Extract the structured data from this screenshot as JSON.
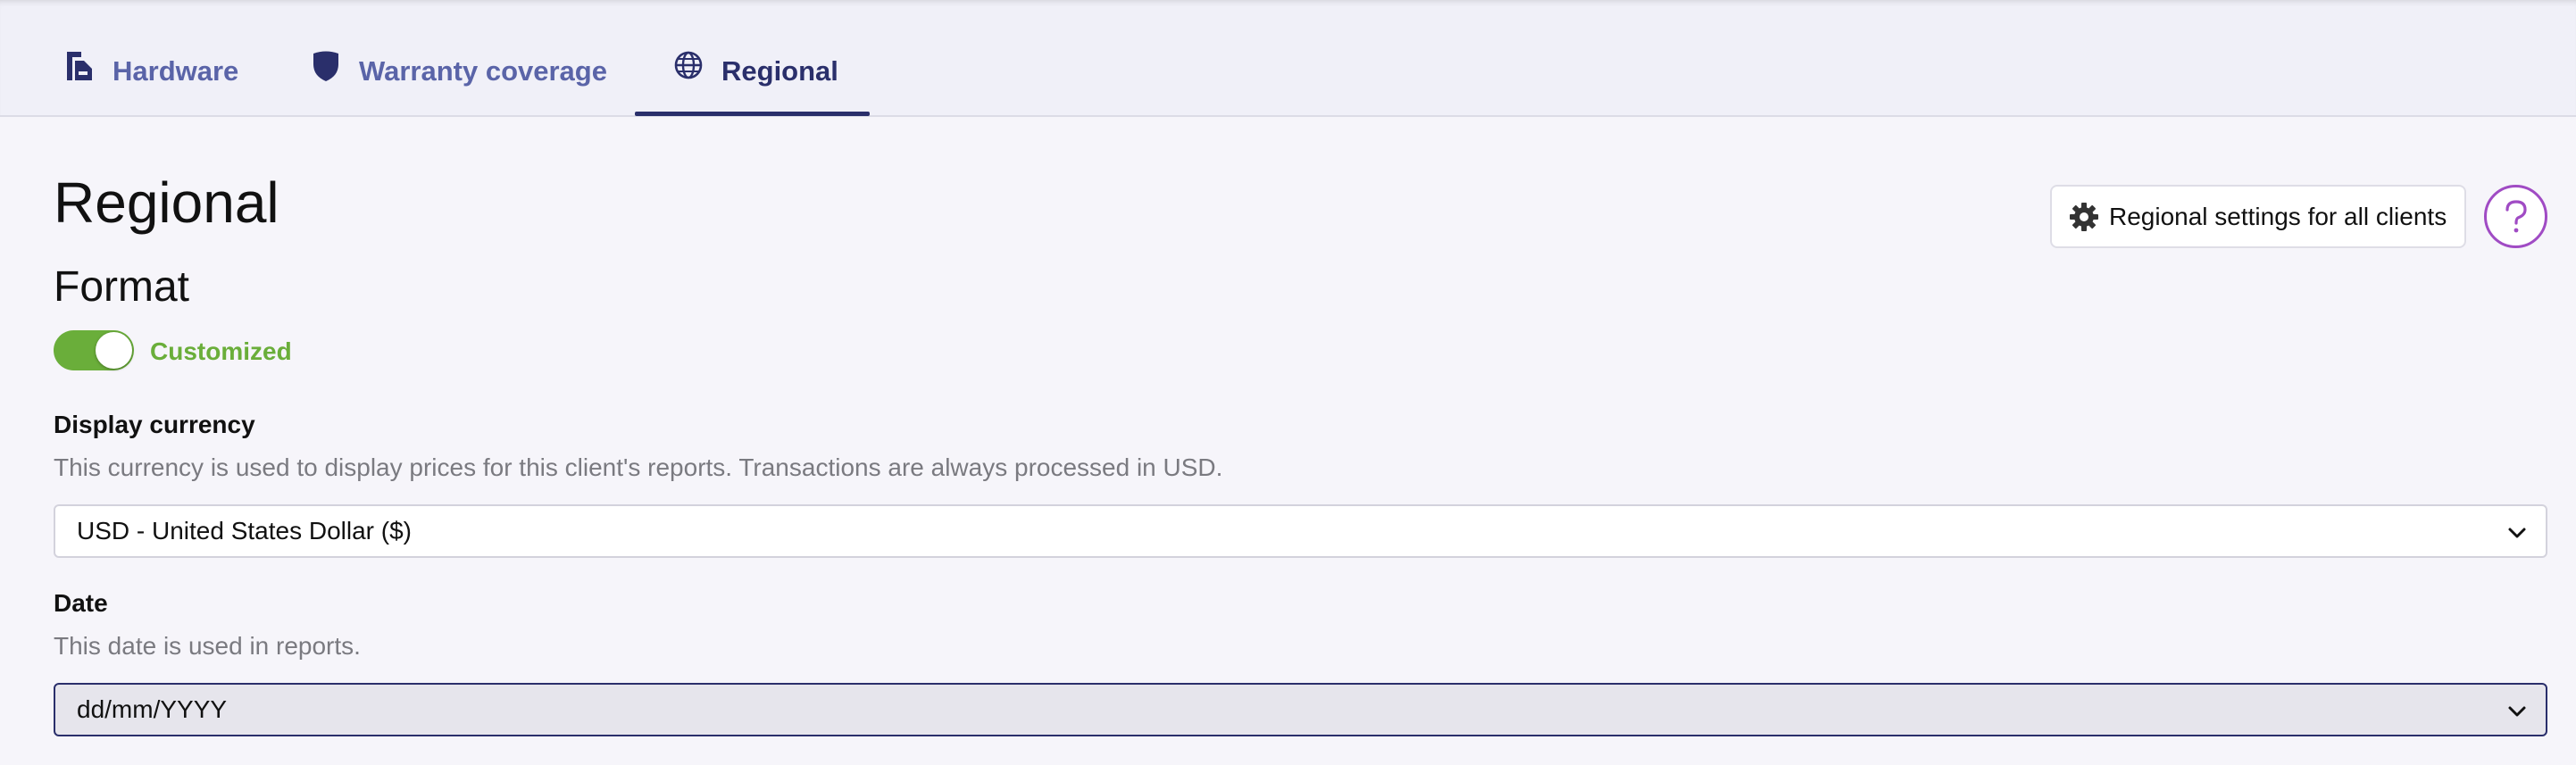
{
  "tabs": [
    {
      "label": "Hardware",
      "icon": "hardware-icon",
      "active": false
    },
    {
      "label": "Warranty coverage",
      "icon": "shield-icon",
      "active": false
    },
    {
      "label": "Regional",
      "icon": "globe-icon",
      "active": true
    }
  ],
  "page": {
    "title": "Regional",
    "settings_button": "Regional settings for all clients",
    "help_icon": "question-icon"
  },
  "format": {
    "title": "Format",
    "toggle_on": true,
    "toggle_label": "Customized"
  },
  "currency": {
    "label": "Display currency",
    "description": "This currency is used to display prices for this client's reports. Transactions are always processed in USD.",
    "selected": "USD - United States Dollar ($)"
  },
  "date": {
    "label": "Date",
    "description": "This date is used in reports.",
    "selected": "dd/mm/YYYY"
  },
  "colors": {
    "accent": "#2a2f6b",
    "tab_inactive": "#5a64a8",
    "toggle_green": "#6aae3a",
    "help_purple": "#a04bc4"
  }
}
